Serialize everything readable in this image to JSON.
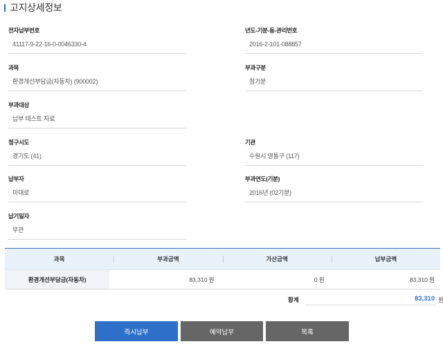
{
  "section": {
    "title": "고지상세정보"
  },
  "fields": {
    "e_payment_no": {
      "label": "전자납부번호",
      "value": "41117-9-22-16-0-0046330-4"
    },
    "year_mgmt_no": {
      "label": "년도-기분-동-관리번호",
      "value": "2016-2-101-088857"
    },
    "subject": {
      "label": "과목",
      "value": "환경개선부담금(자동차) (900002)"
    },
    "levy_type": {
      "label": "부과구분",
      "value": "정기분"
    },
    "levy_target": {
      "label": "부과대상",
      "value": "납부 테스트 자료"
    },
    "province": {
      "label": "청구시도",
      "value": "경기도 (41)"
    },
    "agency": {
      "label": "기관",
      "value": "수원시 영통구 (117)"
    },
    "payer": {
      "label": "납부자",
      "value": "이대로"
    },
    "levy_year": {
      "label": "부과연도(기분)",
      "value": "2016년 (02기분)"
    },
    "due_date": {
      "label": "납기일자",
      "value": "무관"
    }
  },
  "table": {
    "headers": [
      "과목",
      "부과금액",
      "가산금액",
      "납부금액"
    ],
    "rows": [
      {
        "category": "환경개선부담금(자동차)",
        "levy": "83,310 원",
        "surcharge": "0 원",
        "payment": "83,310 원"
      }
    ]
  },
  "total": {
    "label": "합계",
    "amount": "83,310",
    "unit": "원"
  },
  "buttons": {
    "pay_now": "즉시납부",
    "reserve_pay": "예약납부",
    "list": "목록"
  },
  "colors": {
    "accent": "#2e6fc8",
    "header_bg": "#e9f1fb",
    "button_gray": "#666666"
  }
}
